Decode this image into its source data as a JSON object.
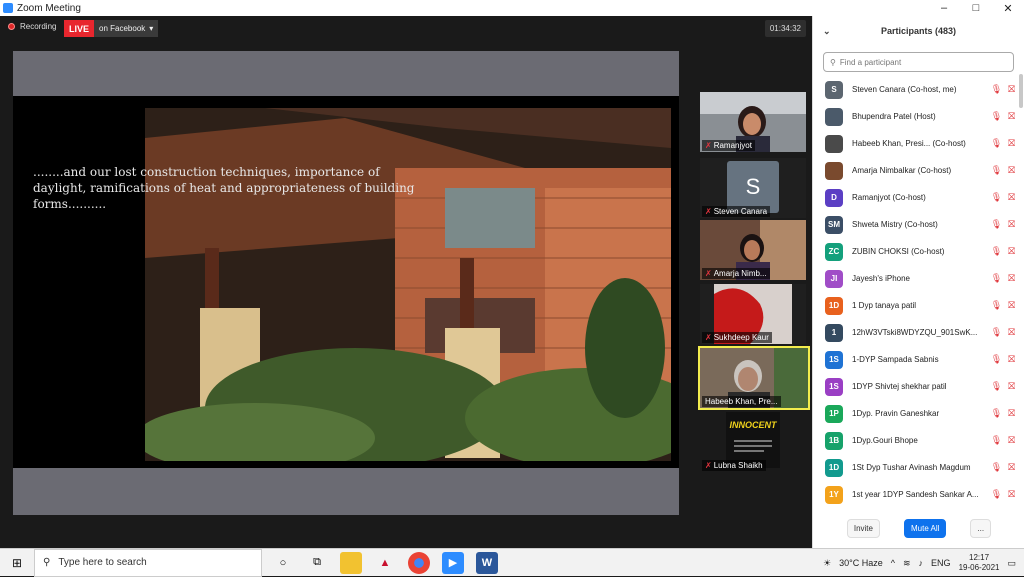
{
  "window": {
    "title": "Zoom Meeting",
    "controls": [
      "–",
      "□",
      "✕"
    ]
  },
  "meeting": {
    "recording_label": "Recording",
    "live_badge": "LIVE",
    "live_target": "on Facebook",
    "live_caret": "▾",
    "timer": "01:34:32",
    "slide_text": "........and our lost construction techniques, importance of daylight, ramifications of heat and appropriateness of building forms.........."
  },
  "gallery": [
    {
      "name": "Ramanjyot",
      "muted": true
    },
    {
      "name": "Steven Canara",
      "initial": "S",
      "muted": true
    },
    {
      "name": "Amarja Nimb...",
      "muted": true
    },
    {
      "name": "Sukhdeep Kaur",
      "muted": true
    },
    {
      "name": "Habeeb Khan, Pre...",
      "muted": false,
      "active": true
    },
    {
      "name": "Lubna Shaikh",
      "muted": true,
      "poster_text": "INNOCENT"
    }
  ],
  "participants": {
    "title": "Participants (483)",
    "search_placeholder": "Find a participant",
    "list": [
      {
        "initials": "S",
        "color": "#5c6670",
        "name": "Steven Canara (Co-host, me)"
      },
      {
        "initials": "",
        "color": "#4b5a6a",
        "name": "Bhupendra Patel (Host)"
      },
      {
        "initials": "",
        "color": "#4a4a4a",
        "name": "Habeeb Khan, Presi... (Co-host)"
      },
      {
        "initials": "",
        "color": "#7a4a2e",
        "name": "Amarja Nimbalkar (Co-host)"
      },
      {
        "initials": "D",
        "color": "#5b3fc4",
        "name": "Ramanjyot (Co-host)"
      },
      {
        "initials": "SM",
        "color": "#3b4e66",
        "name": "Shweta Mistry (Co-host)"
      },
      {
        "initials": "ZC",
        "color": "#14a07c",
        "name": "ZUBIN CHOKSI (Co-host)"
      },
      {
        "initials": "JI",
        "color": "#a04dc7",
        "name": "Jayesh's iPhone"
      },
      {
        "initials": "1D",
        "color": "#e8611e",
        "name": "1 Dyp tanaya patil"
      },
      {
        "initials": "1",
        "color": "#344a60",
        "name": "12hW3VTski8WDYZQU_901SwK..."
      },
      {
        "initials": "1S",
        "color": "#1f73d4",
        "name": "1-DYP Sampada Sabnis"
      },
      {
        "initials": "1S",
        "color": "#9a3fc4",
        "name": "1DYP Shivtej shekhar patil"
      },
      {
        "initials": "1P",
        "color": "#1aa85a",
        "name": "1Dyp. Pravin Ganeshkar"
      },
      {
        "initials": "1B",
        "color": "#16a26a",
        "name": "1Dyp.Gouri Bhope"
      },
      {
        "initials": "1D",
        "color": "#129a8e",
        "name": "1St Dyp Tushar Avinash Magdum"
      },
      {
        "initials": "1Y",
        "color": "#f3a21b",
        "name": "1st year 1DYP Sandesh Sankar A..."
      }
    ],
    "invite_label": "Invite",
    "mute_all_label": "Mute All",
    "more_label": "..."
  },
  "taskbar": {
    "search_placeholder": "Type here to search",
    "weather": "30°C  Haze",
    "language": "ENG",
    "time": "12:17",
    "date": "19-06-2021"
  }
}
